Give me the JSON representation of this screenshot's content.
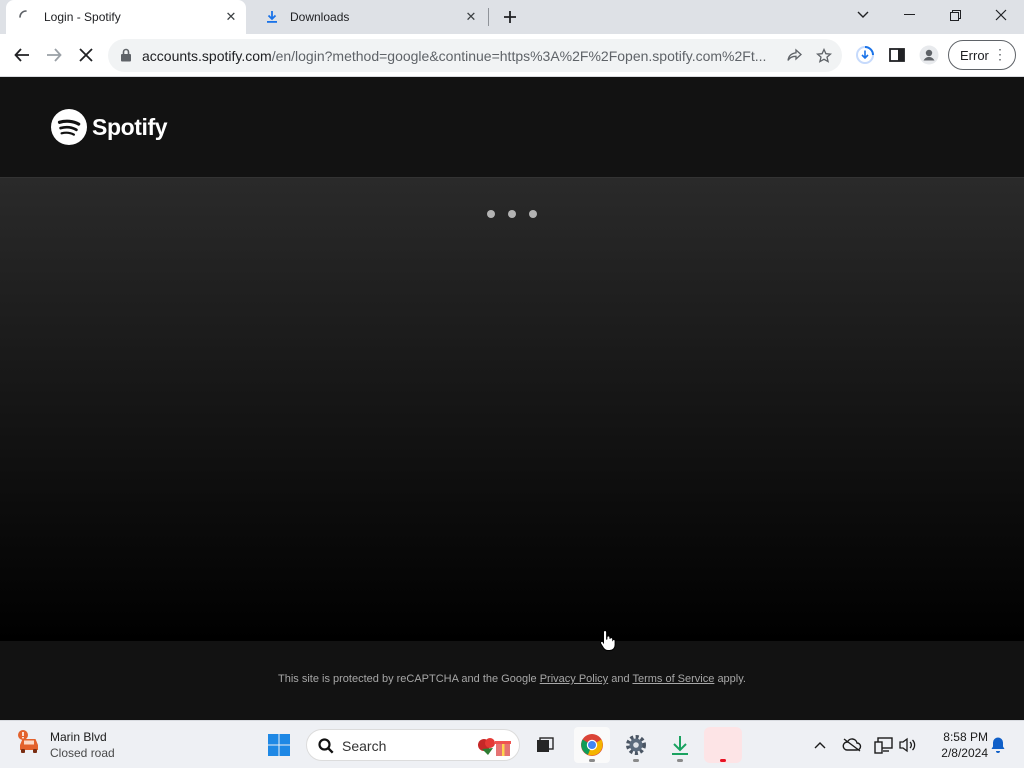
{
  "browser": {
    "tabs": [
      {
        "title": "Login - Spotify",
        "state": "loading"
      },
      {
        "title": "Downloads"
      }
    ],
    "url_host": "accounts.spotify.com",
    "url_rest": "/en/login?method=google&continue=https%3A%2F%2Fopen.spotify.com%2Ft...",
    "error_label": "Error"
  },
  "page": {
    "brand": "Spotify",
    "footer": {
      "text_before": "This site is protected by reCAPTCHA and the Google",
      "privacy_link": "Privacy Policy",
      "and": "and",
      "terms_link": "Terms of Service",
      "text_after": "apply."
    },
    "colors": {
      "background": "#121212",
      "brand_green": "#1ed760"
    }
  },
  "taskbar": {
    "weather": {
      "location": "Marin Blvd",
      "status": "Closed road"
    },
    "search_placeholder": "Search",
    "clock": {
      "time": "8:58 PM",
      "date": "2/8/2024"
    }
  }
}
